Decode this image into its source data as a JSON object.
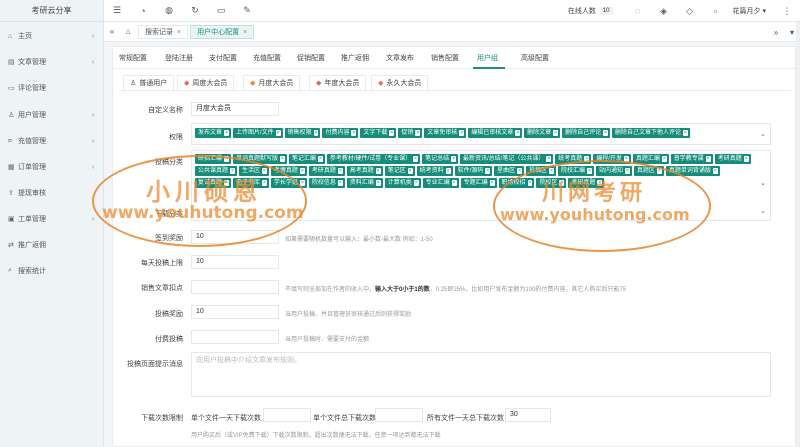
{
  "sidebar": {
    "brand": "考研云分享",
    "items": [
      {
        "icon": "home-icon",
        "glyph": "⌂",
        "label": "主页",
        "chevron": "‹"
      },
      {
        "icon": "document-icon",
        "glyph": "▤",
        "label": "文章管理",
        "chevron": "‹"
      },
      {
        "icon": "comment-icon",
        "glyph": "▭",
        "label": "评论管理",
        "chevron": ""
      },
      {
        "icon": "user-icon",
        "glyph": "♙",
        "label": "用户管理",
        "chevron": "‹"
      },
      {
        "icon": "recharge-icon",
        "glyph": "¤",
        "label": "充值管理",
        "chevron": "‹"
      },
      {
        "icon": "order-icon",
        "glyph": "▦",
        "label": "订单管理",
        "chevron": "‹"
      },
      {
        "icon": "withdraw-icon",
        "glyph": "⇪",
        "label": "提现审核",
        "chevron": ""
      },
      {
        "icon": "ticket-icon",
        "glyph": "▣",
        "label": "工单管理",
        "chevron": "‹"
      },
      {
        "icon": "referral-icon",
        "glyph": "⇄",
        "label": "推广返佣",
        "chevron": ""
      },
      {
        "icon": "search-stats-icon",
        "glyph": "⌕",
        "label": "搜索统计",
        "chevron": ""
      }
    ]
  },
  "topbar": {
    "icons": [
      {
        "name": "menu-toggle-icon",
        "glyph": "☰"
      },
      {
        "name": "dashboard-icon",
        "glyph": "◔"
      },
      {
        "name": "globe-icon",
        "glyph": "◍"
      },
      {
        "name": "refresh-icon",
        "glyph": "↻"
      },
      {
        "name": "cart-icon",
        "glyph": "▭"
      },
      {
        "name": "brush-icon",
        "glyph": "✎"
      }
    ],
    "online_label": "在线人数",
    "online_count": "10",
    "right_icons": [
      {
        "name": "bell-icon",
        "glyph": "◌"
      },
      {
        "name": "skin-icon",
        "glyph": "◈"
      },
      {
        "name": "tag-icon",
        "glyph": "◇"
      },
      {
        "name": "notification-icon",
        "glyph": "▫"
      }
    ],
    "user_name": "花篇月夕 ▾"
  },
  "tabstrip": {
    "tabs": [
      {
        "label": "搜索记录",
        "active": false
      },
      {
        "label": "用户中心配置",
        "active": true
      }
    ],
    "left_arrows": "«",
    "right_arrows": [
      "»",
      "▾"
    ]
  },
  "nav_tabs": [
    "常规配置",
    "登陆注册",
    "支付配置",
    "充值配置",
    "促销配置",
    "推广返佣",
    "文章发布",
    "销售配置",
    "用户组",
    "高级配置"
  ],
  "nav_active": "用户组",
  "group_tabs": [
    {
      "icon": "user-icon",
      "glyph": "♙",
      "label": "普通用户"
    },
    {
      "icon": "diamond-icon",
      "glyph": "◆",
      "label": "周度大会员"
    },
    {
      "icon": "diamond-icon",
      "glyph": "◆",
      "label": "月度大会员"
    },
    {
      "icon": "diamond-icon",
      "glyph": "◆",
      "label": "年度大会员"
    },
    {
      "icon": "diamond-icon",
      "glyph": "◆",
      "label": "永久大会员"
    }
  ],
  "form": {
    "custom_name_label": "自定义名称",
    "custom_name_value": "月度大会员",
    "permissions_label": "权限",
    "permissions": [
      "发布文章",
      "上传图片/文件",
      "销售权限",
      "付费内容",
      "文字下载",
      "促销",
      "文章免审核",
      "编辑已审核文章",
      "删除文章",
      "删除自己评论",
      "删除自己文章下他人评论"
    ],
    "categories_label": "投稿分类",
    "categories": [
      "研招汇编",
      "单词真题默写版",
      "笔记汇编",
      "参考教材/硬件/试卷（专业课）",
      "笔记总结",
      "最新资讯/总结/笔记（公共课）",
      "统考真题",
      "编程/开发",
      "真题汇编",
      "普学教专属",
      "考研真题",
      "公共课真题",
      "生活区",
      "考博真题",
      "考研真题",
      "高考真题",
      "笔记区",
      "统考资料",
      "软件/源码",
      "星曲区",
      "投稿区",
      "院校汇编",
      "站内通知",
      "真题区",
      "真题单词背诵版",
      "复试真题",
      "电子书库",
      "学长学姐",
      "院校信息",
      "资料汇编",
      "计算机类",
      "专业汇编",
      "专题汇编",
      "职场校招",
      "院校区",
      "考研真题"
    ],
    "download_category_label": "下载分类",
    "signin_label": "签到奖励",
    "signin_value": "10",
    "signin_help": "如果需要随机数量可以输入：最小数-最大数 例如：1-50",
    "daily_limit_label": "每天投稿上限",
    "daily_limit_value": "10",
    "sales_deduct_label": "销售文章扣点",
    "sales_deduct_help_pre": "不填写则全部加在作者的收入中，",
    "sales_deduct_help_bold": "输入大于0小于1的数",
    "sales_deduct_help_post": "，0.25即25%，比如用户发布金额为100的付费内容，其它人购买后只能75",
    "submit_reward_label": "投稿奖励",
    "submit_reward_value": "10",
    "submit_reward_help": "当用户投稿、并且管理员审核通过后则获得奖励",
    "paid_submit_label": "付费投稿",
    "paid_submit_help": "当用户投稿时、需要支付的金额",
    "submit_page_msg_label": "投稿页面提示消息",
    "submit_page_msg_placeholder": "向用户投稿中介绍文章发布规则。",
    "download_limit_label": "下载次数限制",
    "per_file_day_label": "单个文件一天下载次数",
    "per_file_total_label": "单个文件总下载次数",
    "all_files_day_label": "所有文件一天总下载次数",
    "all_files_day_value": "30",
    "download_limit_help": "用户购买后（或VIP免费下载）下载次数限制，超出次数便无法下载，任意一项达到都无法下载"
  },
  "watermark": {
    "left_cn": "小川硕恩",
    "left_url": "www.youhutong.com",
    "right_cn": "川网考研",
    "right_url": "www.youhutong.com"
  }
}
